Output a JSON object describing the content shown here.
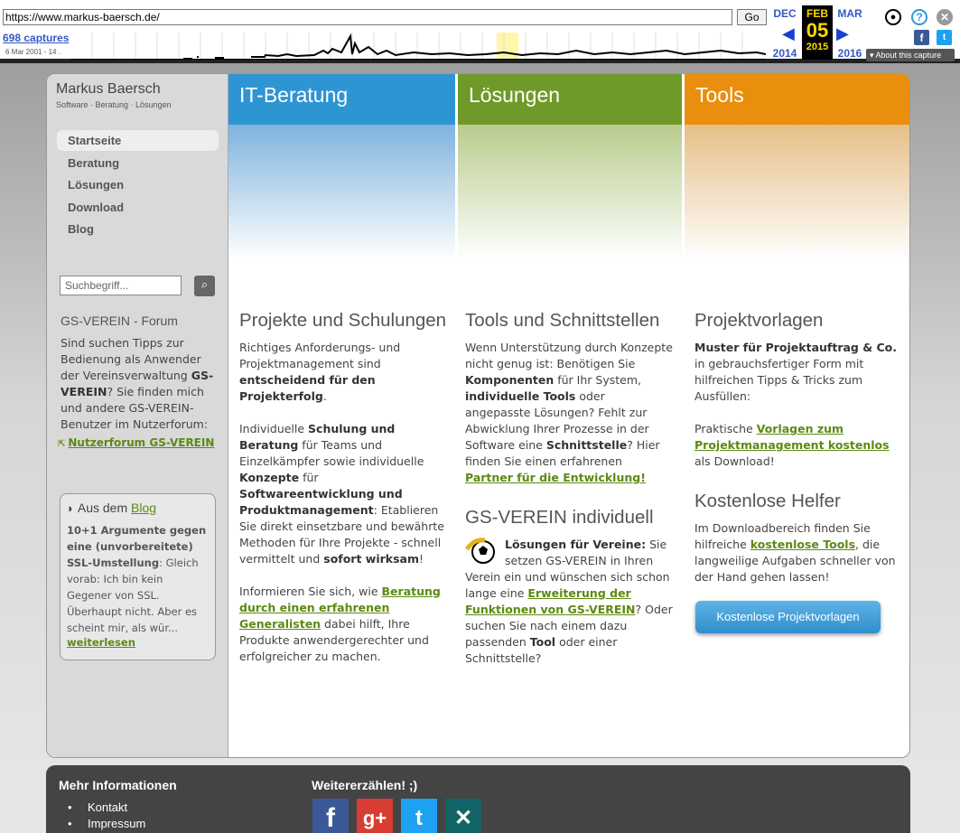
{
  "wayback": {
    "url": "https://www.markus-baersch.de/",
    "go_label": "Go",
    "captures": "698 captures",
    "date_range": "6 Mar 2001 - 14 .",
    "prev_month": "DEC",
    "prev_year": "2014",
    "cur_month": "FEB",
    "cur_day": "05",
    "cur_year": "2015",
    "next_month": "MAR",
    "next_year": "2016",
    "about": "About this capture"
  },
  "sidebar": {
    "brand": "Markus Baersch",
    "tagline": "Software · Beratung · Lösungen",
    "nav": [
      "Startseite",
      "Beratung",
      "Lösungen",
      "Download",
      "Blog"
    ],
    "search_placeholder": "Suchbegriff...",
    "forum_heading": "GS-VEREIN - Forum",
    "forum_text_1": "Sind suchen Tipps zur Bedienung als Anwender der Vereinsverwaltung ",
    "forum_text_bold_1": "GS-VEREIN",
    "forum_text_2": "? Sie finden mich und andere GS-VEREIN-Benutzer im Nutzerforum:",
    "forum_link": "Nutzerforum GS-VEREIN",
    "blog_heading_prefix": "Aus dem ",
    "blog_heading_link": "Blog",
    "blog_title": "10+1 Argumente gegen eine (unvorbereitete) SSL-Umstellung",
    "blog_excerpt": ": Gleich vorab: Ich bin kein Gegener von SSL. Überhaupt nicht. Aber es scheint mir, als wür...",
    "blog_more": "weiterlesen"
  },
  "columns": {
    "c1": {
      "header": "IT-Beratung",
      "title": "Projekte und Schulungen",
      "p1a": "Richtiges Anforderungs- und Projektmanagement sind ",
      "p1b": "entscheidend für den Projekterfolg",
      "p1c": ".",
      "p2a": "Individuelle ",
      "p2b": "Schulung und Beratung",
      "p2c": " für Teams und Einzelkämpfer sowie individuelle ",
      "p2d": "Konzepte",
      "p2e": " für ",
      "p2f": "Softwareentwicklung und Produktmanagement",
      "p2g": ": Etablieren Sie direkt einsetzbare und bewährte Methoden für Ihre Projekte - schnell vermittelt und ",
      "p2h": "sofort wirksam",
      "p2i": "!",
      "p3a": "Informieren Sie sich, wie ",
      "p3link": "Beratung durch einen erfahrenen Generalisten",
      "p3b": " dabei hilft, Ihre Produkte anwendergerechter und erfolgreicher zu machen."
    },
    "c2": {
      "header": "Lösungen",
      "title": "Tools und Schnittstellen",
      "p1a": "Wenn Unterstützung durch Konzepte nicht genug ist: Benötigen Sie ",
      "p1b": "Komponenten",
      "p1c": " für Ihr System, ",
      "p1d": "individuelle Tools",
      "p1e": " oder angepasste Lösungen? Fehlt zur Abwicklung Ihrer Prozesse in der Software eine ",
      "p1f": "Schnittstelle",
      "p1g": "? Hier finden Sie einen erfahrenen ",
      "p1link": "Partner für die Entwicklung!",
      "title2": "GS-VEREIN individuell",
      "p2b": "Lösungen für Vereine:",
      "p2a": " Sie setzen GS-VEREIN in Ihren Verein ein und wünschen sich schon lange eine ",
      "p2link": "Erweiterung der Funktionen von GS-VEREIN",
      "p2c": "? Oder suchen Sie nach einem dazu passenden ",
      "p2d": "Tool",
      "p2e": " oder einer Schnittstelle?"
    },
    "c3": {
      "header": "Tools",
      "title": "Projektvorlagen",
      "p1b": "Muster für Projektauftrag & Co.",
      "p1a": " in gebrauchsfertiger Form mit hilfreichen Tipps & Tricks zum Ausfüllen:",
      "p2a": "Praktische ",
      "p2link": "Vorlagen zum Projektmanagement kostenlos",
      "p2b": " als Download!",
      "title2": "Kostenlose Helfer",
      "p3a": "Im Downloadbereich finden Sie hilfreiche ",
      "p3link": "kostenlose Tools",
      "p3b": ", die langweilige Aufgaben schneller von der Hand gehen lassen!",
      "cta": "Kostenlose Projektvorlagen"
    }
  },
  "footer": {
    "more_heading": "Mehr Informationen",
    "links": [
      "Kontakt",
      "Impressum"
    ],
    "share_heading": "Weitererzählen! ;)",
    "social": [
      "facebook",
      "google-plus",
      "twitter",
      "xing"
    ]
  },
  "colors": {
    "blue": "#2e95d3",
    "green": "#6f9a2a",
    "orange": "#e98e0d",
    "link_green": "#5c8a13"
  }
}
